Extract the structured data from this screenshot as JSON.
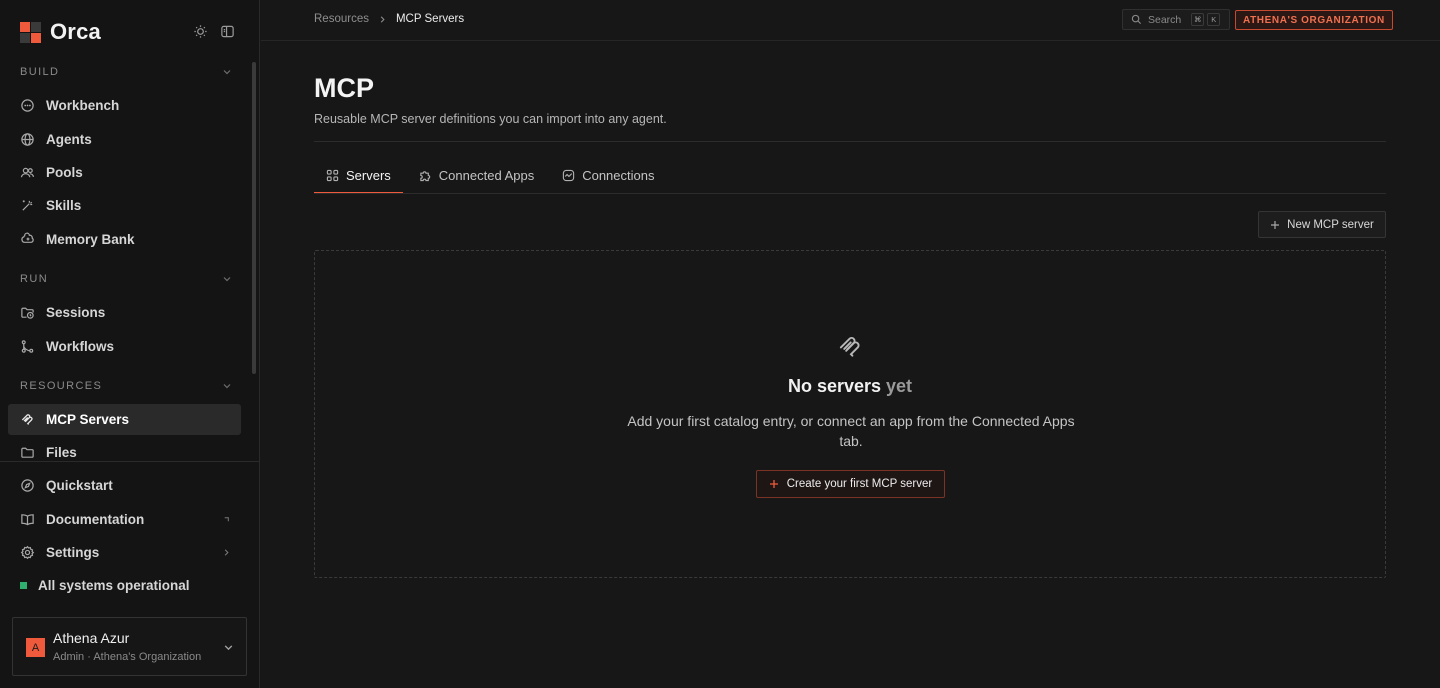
{
  "app": {
    "name": "Orca",
    "brand_color": "#f05a3c"
  },
  "sidebar": {
    "sections": [
      {
        "title": "BUILD",
        "items": [
          {
            "label": "Workbench",
            "icon": "chat-bubble-icon"
          },
          {
            "label": "Agents",
            "icon": "globe-icon"
          },
          {
            "label": "Pools",
            "icon": "users-icon"
          },
          {
            "label": "Skills",
            "icon": "wand-icon"
          },
          {
            "label": "Memory Bank",
            "icon": "brain-icon"
          }
        ]
      },
      {
        "title": "RUN",
        "items": [
          {
            "label": "Sessions",
            "icon": "folder-clock-icon"
          },
          {
            "label": "Workflows",
            "icon": "git-branch-icon"
          }
        ]
      },
      {
        "title": "RESOURCES",
        "items": [
          {
            "label": "MCP Servers",
            "icon": "mcp-icon",
            "active": true
          },
          {
            "label": "Files",
            "icon": "folder-icon"
          }
        ]
      }
    ],
    "bottom_items": [
      {
        "label": "Quickstart",
        "icon": "compass-icon"
      },
      {
        "label": "Documentation",
        "icon": "book-icon"
      },
      {
        "label": "Settings",
        "icon": "gear-icon"
      }
    ],
    "status": {
      "label": "All systems operational",
      "color": "#2fae6e"
    },
    "user": {
      "initial": "A",
      "name": "Athena Azur",
      "role": "Admin · Athena's Organization"
    }
  },
  "topbar": {
    "breadcrumb": [
      "Resources",
      "MCP Servers"
    ],
    "search": {
      "placeholder": "Search",
      "keys": [
        "⌘",
        "K"
      ]
    },
    "org_badge": "ATHENA'S ORGANIZATION"
  },
  "main": {
    "title": "MCP",
    "subtitle": "Reusable MCP server definitions you can import into any agent.",
    "tabs": [
      {
        "label": "Servers",
        "icon": "grid-icon",
        "active": true
      },
      {
        "label": "Connected Apps",
        "icon": "puzzle-icon"
      },
      {
        "label": "Connections",
        "icon": "activity-icon"
      }
    ],
    "new_button": "New MCP server",
    "empty_state": {
      "title": "No servers",
      "title_muted": "yet",
      "description": "Add your first catalog entry, or connect an app from the Connected Apps tab.",
      "button": "Create your first MCP server"
    }
  }
}
